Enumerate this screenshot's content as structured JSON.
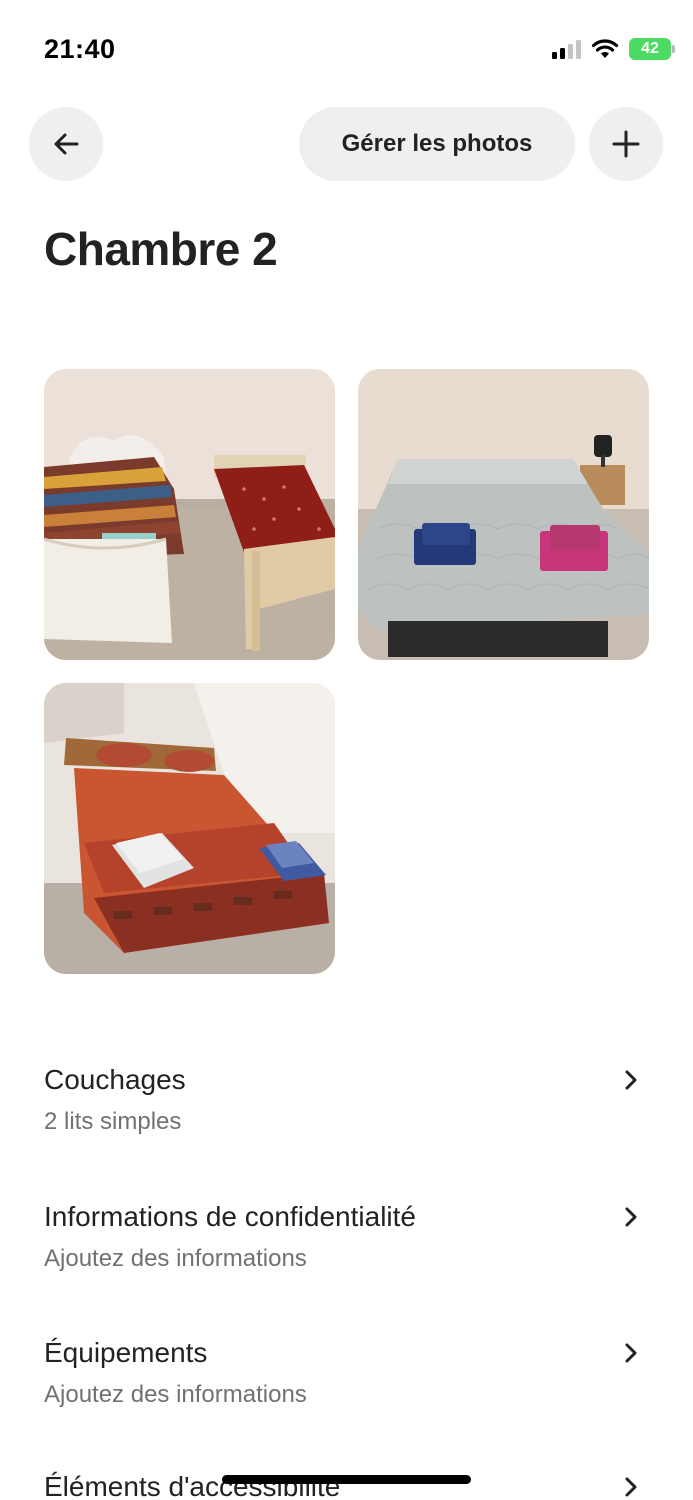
{
  "status_bar": {
    "time": "21:40",
    "battery": "42"
  },
  "header": {
    "back_icon": "arrow-left-icon",
    "manage_photos_label": "Gérer les photos",
    "add_icon": "plus-icon"
  },
  "page": {
    "title": "Chambre 2"
  },
  "photos": [
    {
      "description_icon": "bedroom-photo"
    },
    {
      "description_icon": "bedroom-photo"
    },
    {
      "description_icon": "bedroom-photo"
    }
  ],
  "sections": [
    {
      "title": "Couchages",
      "subtitle": "2 lits simples"
    },
    {
      "title": "Informations de confidentialité",
      "subtitle": "Ajoutez des informations"
    },
    {
      "title": "Équipements",
      "subtitle": "Ajoutez des informations"
    },
    {
      "title": "Éléments d'accessibilité",
      "subtitle": ""
    }
  ],
  "colors": {
    "text_primary": "#222222",
    "text_secondary": "#717171",
    "button_bg": "#efefef",
    "battery_green": "#4cd964"
  }
}
